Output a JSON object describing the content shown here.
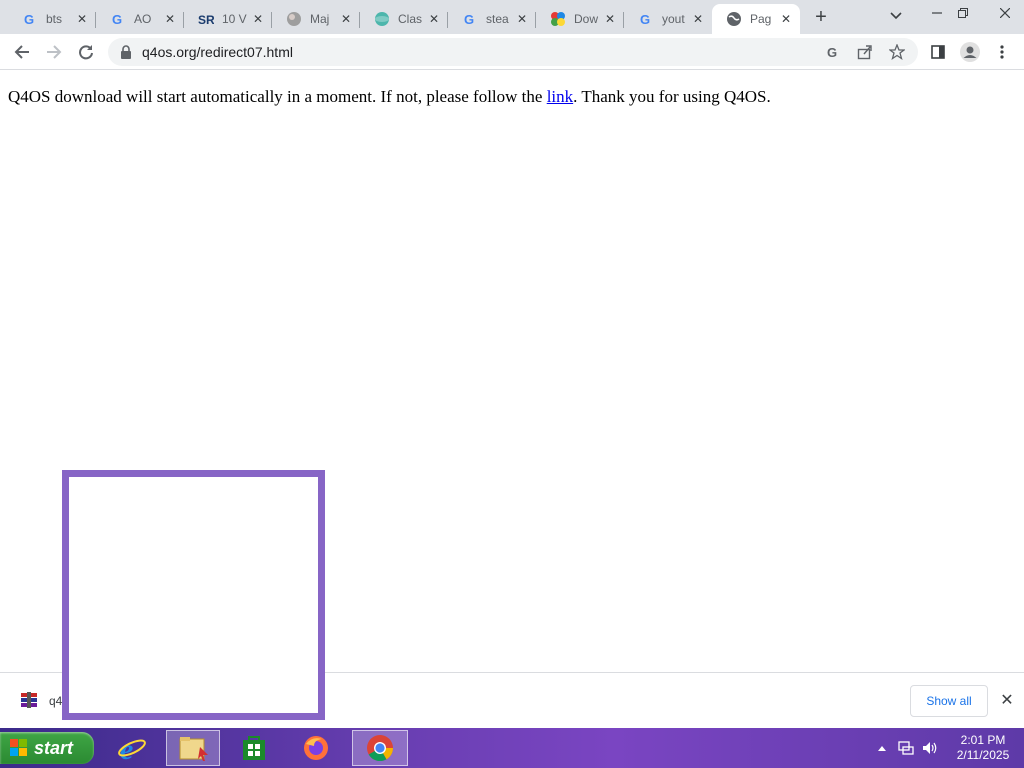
{
  "browser": {
    "tabs": [
      {
        "label": "bts",
        "icon": "google-icon"
      },
      {
        "label": "AO",
        "icon": "google-icon"
      },
      {
        "label": "10 V",
        "icon": "sr-logo-icon"
      },
      {
        "label": "Maj",
        "icon": "grey-favicon-icon"
      },
      {
        "label": "Clas",
        "icon": "globe-teal-icon"
      },
      {
        "label": "stea",
        "icon": "google-icon"
      },
      {
        "label": "Dow",
        "icon": "q4os-logo-icon"
      },
      {
        "label": "yout",
        "icon": "google-icon"
      },
      {
        "label": "Pag",
        "icon": "globe-icon",
        "active": true
      }
    ],
    "url": "q4os.org/redirect07.html"
  },
  "page": {
    "message_before": "Q4OS download will start automatically in a moment. If not, please follow the ",
    "link_text": "link",
    "message_after": ". Thank you for using Q4OS."
  },
  "download_bar": {
    "file_name": "q4",
    "show_all": "Show all"
  },
  "taskbar": {
    "start_label": "start",
    "time": "2:01 PM",
    "date": "2/11/2025"
  },
  "colors": {
    "overlay_border": "#8765c6",
    "link": "#0000ee",
    "show_all": "#1a73e8"
  }
}
